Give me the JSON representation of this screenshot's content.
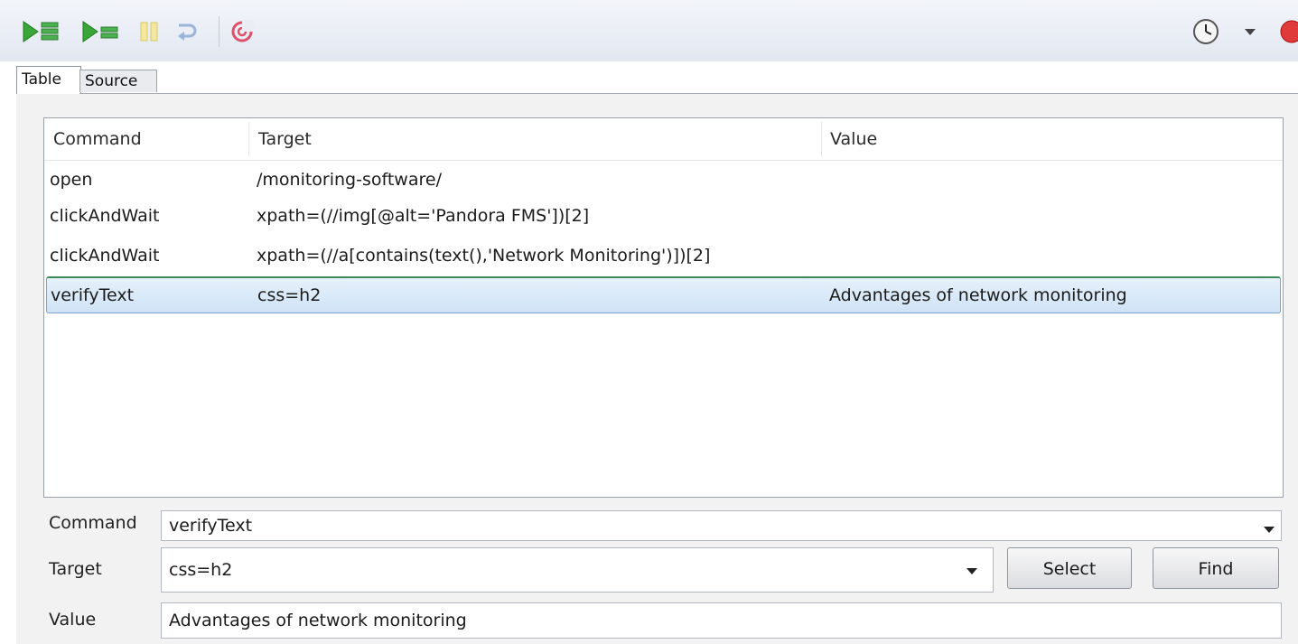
{
  "toolbar": {
    "icons": [
      "play-suite-icon",
      "play-test-icon",
      "pause-icon",
      "step-icon",
      "rollup-icon",
      "clock-icon",
      "dropdown-icon",
      "record-icon"
    ]
  },
  "tabs": [
    {
      "label": "Table"
    },
    {
      "label": "Source"
    }
  ],
  "grid": {
    "headers": {
      "command": "Command",
      "target": "Target",
      "value": "Value"
    },
    "rows": [
      {
        "command": "open",
        "target": "/monitoring-software/",
        "value": ""
      },
      {
        "command": "clickAndWait",
        "target": "xpath=(//img[@alt='Pandora FMS'])[2]",
        "value": ""
      },
      {
        "command": "clickAndWait",
        "target": "xpath=(//a[contains(text(),'Network Monitoring')])[2]",
        "value": ""
      },
      {
        "command": "verifyText",
        "target": "css=h2",
        "value": "Advantages of network monitoring"
      }
    ]
  },
  "form": {
    "command_label": "Command",
    "command_value": "verifyText",
    "target_label": "Target",
    "target_value": "css=h2",
    "value_label": "Value",
    "value_value": "Advantages of network monitoring",
    "select_label": "Select",
    "find_label": "Find"
  }
}
